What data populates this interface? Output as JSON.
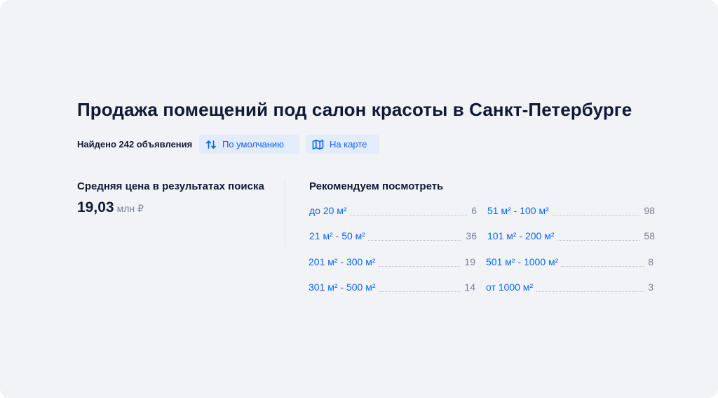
{
  "header": {
    "title": "Продажа помещений под салон красоты в Санкт-Петербурге",
    "found_text": "Найдено 242 объявления",
    "sort_button": {
      "label": "По умолчанию",
      "icon": "sort-arrows-icon"
    },
    "map_button": {
      "label": "На карте",
      "icon": "map-icon"
    }
  },
  "average_price": {
    "label": "Средняя цена в результатах поиска",
    "value": "19,03",
    "unit": "млн ₽"
  },
  "recommendations": {
    "title": "Рекомендуем посмотреть",
    "items": [
      {
        "label": "до 20 м²",
        "count": "6"
      },
      {
        "label": "51 м² - 100 м²",
        "count": "98"
      },
      {
        "label": "21 м² - 50 м²",
        "count": "36"
      },
      {
        "label": "101 м² - 200 м²",
        "count": "58"
      },
      {
        "label": "201 м² - 300 м²",
        "count": "19"
      },
      {
        "label": "501 м² - 1000 м²",
        "count": "8"
      },
      {
        "label": "301 м² - 500 м²",
        "count": "14"
      },
      {
        "label": "от 1000 м²",
        "count": "3"
      }
    ]
  },
  "colors": {
    "background": "#f2f3f6",
    "text": "#0f1a36",
    "accent": "#0468ff",
    "chip_bg": "#e3ecfb",
    "muted": "#7a8299"
  }
}
